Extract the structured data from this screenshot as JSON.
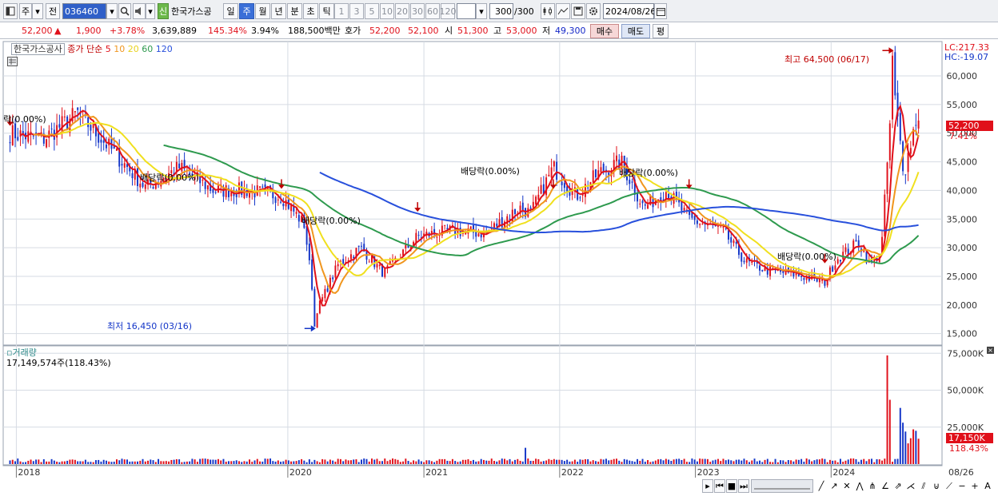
{
  "toolbar": {
    "period_label": "주",
    "prev_label": "전",
    "stock_code": "036460",
    "new_badge": "신",
    "stock_name": "한국가스공",
    "periods": [
      "일",
      "주",
      "월",
      "년",
      "분",
      "초",
      "틱"
    ],
    "selected_period": "주",
    "intervals": [
      "1",
      "3",
      "5",
      "10",
      "20",
      "30",
      "60",
      "120"
    ],
    "count_value": "300",
    "count_total": "/300",
    "date_value": "2024/08/26"
  },
  "info": {
    "price": "52,200",
    "arrow": "▲",
    "change": "1,900",
    "change_pct": "+3.78%",
    "volume": "3,639,889",
    "volume_ratio": "145.34%",
    "turnover": "3.94%",
    "amount": "188,500백만",
    "hoga_label": "호가",
    "ask": "52,200",
    "bid": "52,100",
    "open_label": "시",
    "open": "51,300",
    "high_label": "고",
    "high": "53,000",
    "low_label": "저",
    "low": "49,300",
    "buy_label": "매수",
    "sell_label": "매도",
    "eval_label": "평"
  },
  "legend": {
    "stock": "한국가스공사",
    "desc": "종가 단순",
    "ma5": "5",
    "ma10": "10",
    "ma20": "20",
    "ma60": "60",
    "ma120": "120"
  },
  "price_axis": {
    "lc": "LC:217.33",
    "hc": "HC:-19.07",
    "last_price": "52,200",
    "last_pct": "7.41%"
  },
  "volume_panel": {
    "title": "거래량",
    "summary": "17,149,574주(118.43%)",
    "last_vol": "17,150K",
    "last_pct": "118.43%"
  },
  "annotations": {
    "high": "최고 64,500 (06/17)",
    "low": "최저 16,450 (03/16)",
    "div": "배당락(0.00%)",
    "div_partial": "락(0.00%)"
  },
  "x_end_label": "08/26",
  "colors": {
    "up": "#e0101a",
    "down": "#1436c8",
    "ma5": "#e0101a",
    "ma10": "#f0961e",
    "ma20": "#f0e01e",
    "ma60": "#2e9a4e",
    "ma120": "#2850dc",
    "grid": "#d6dbe3"
  },
  "chart_data": [
    {
      "type": "line",
      "title": "",
      "frequency": "weekly",
      "y_ticks": [
        15000,
        20000,
        25000,
        30000,
        35000,
        40000,
        45000,
        50000,
        55000,
        60000
      ],
      "ylim": [
        13000,
        66000
      ],
      "x_labels": [
        "2018",
        "2020",
        "2021",
        "2022",
        "2023",
        "2024"
      ],
      "x_label_dates": [
        "2018-01",
        "2020-01",
        "2021-01",
        "2022-01",
        "2023-01",
        "2024-01"
      ],
      "x_end_date": "2024-08-26",
      "close_anchors": {
        "dates": [
          "2017-12",
          "2018-03",
          "2018-06",
          "2018-09",
          "2018-12",
          "2019-03",
          "2019-06",
          "2019-09",
          "2019-12",
          "2020-02",
          "2020-03",
          "2020-05",
          "2020-07",
          "2020-09",
          "2020-12",
          "2021-03",
          "2021-06",
          "2021-09",
          "2021-10",
          "2021-12",
          "2022-02",
          "2022-04",
          "2022-06",
          "2022-08",
          "2022-10",
          "2022-12",
          "2023-03",
          "2023-05",
          "2023-07",
          "2023-09",
          "2023-11",
          "2023-12",
          "2024-01",
          "2024-03",
          "2024-04",
          "2024-05",
          "2024-06",
          "2024-07",
          "2024-08"
        ],
        "values": [
          50000,
          49000,
          53500,
          47000,
          40500,
          44000,
          40000,
          40000,
          39000,
          34000,
          18500,
          27000,
          30000,
          25500,
          32000,
          33000,
          32500,
          37000,
          36000,
          44000,
          39000,
          43000,
          45000,
          37000,
          40000,
          35000,
          33000,
          27500,
          26000,
          25500,
          24500,
          24000,
          28000,
          31000,
          27000,
          29500,
          59000,
          43000,
          52200
        ]
      },
      "series": [
        {
          "name": "5",
          "window": 5
        },
        {
          "name": "10",
          "window": 10
        },
        {
          "name": "20",
          "window": 20
        },
        {
          "name": "60",
          "window": 60
        },
        {
          "name": "120",
          "window": 120
        }
      ],
      "annotations": [
        {
          "text": "최고 64,500 (06/17)",
          "date": "2024-06-17",
          "value": 64500
        },
        {
          "text": "최저 16,450 (03/16)",
          "date": "2020-03-16",
          "value": 16450
        }
      ],
      "dividend_markers": [
        {
          "date": "2017-12",
          "value": 51000
        },
        {
          "date": "2019-12",
          "value": 40000
        },
        {
          "date": "2020-12",
          "value": 36000
        },
        {
          "date": "2021-12",
          "value": 40000
        },
        {
          "date": "2022-12",
          "value": 40000
        },
        {
          "date": "2023-12",
          "value": 27000
        }
      ]
    },
    {
      "type": "bar",
      "title": "거래량",
      "y_ticks": [
        25000,
        50000,
        75000
      ],
      "y_tick_labels": [
        "25,000K",
        "50,000K",
        "75,000K"
      ],
      "ylim": [
        0,
        80000
      ],
      "unit": "K",
      "last_value": 17150,
      "spikes": {
        "dates": [
          "2021-10",
          "2024-06",
          "2024-06",
          "2024-07",
          "2024-07",
          "2024-07",
          "2024-07",
          "2024-08",
          "2024-08",
          "2024-08",
          "2024-08"
        ],
        "values": [
          11000,
          73500,
          43500,
          38000,
          28000,
          22000,
          14000,
          17500,
          23500,
          22500,
          17150
        ]
      }
    }
  ]
}
